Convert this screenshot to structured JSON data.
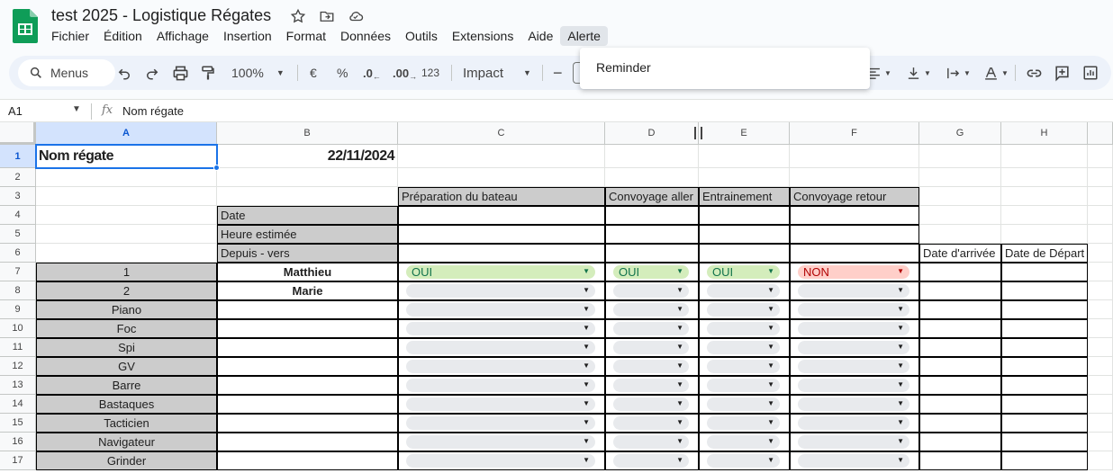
{
  "app": {
    "title": "test 2025 - Logistique Régates",
    "menu": [
      "Fichier",
      "Édition",
      "Affichage",
      "Insertion",
      "Format",
      "Données",
      "Outils",
      "Extensions",
      "Aide",
      "Alerte"
    ]
  },
  "toolbar": {
    "search_label": "Menus",
    "zoom": "100%",
    "currency": "€",
    "percent": "%",
    "dec_decrease": ".0",
    "dec_increase": ".00",
    "number_format": "123",
    "font": "Impact",
    "font_size_minus": "−"
  },
  "dropdown": {
    "item": "Reminder"
  },
  "formula_bar": {
    "cell_ref": "A1",
    "fx": "fx",
    "value": "Nom régate"
  },
  "columns": [
    "A",
    "B",
    "C",
    "D",
    "E",
    "F",
    "G",
    "H"
  ],
  "rows": [
    "1",
    "2",
    "3",
    "4",
    "5",
    "6",
    "7",
    "8",
    "9",
    "10",
    "11",
    "12",
    "13",
    "14",
    "15",
    "16",
    "17"
  ],
  "sheet": {
    "a1": "Nom régate",
    "b1": "22/11/2024",
    "c3": "Préparation du bateau",
    "d3": "Convoyage aller",
    "e3": "Entrainement",
    "f3": "Convoyage retour",
    "b4": "Date",
    "b5": "Heure estimée",
    "b6": "Depuis - vers",
    "g6": "Date d'arrivée",
    "h6": "Date de Départ",
    "col_a": [
      "1",
      "2",
      "Piano",
      "Foc",
      "Spi",
      "GV",
      "Barre",
      "Bastaques",
      "Tacticien",
      "Navigateur",
      "Grinder"
    ],
    "col_b": [
      "Matthieu",
      "Marie"
    ],
    "row7_values": {
      "c": "OUI",
      "d": "OUI",
      "e": "OUI",
      "f": "NON"
    }
  },
  "colors": {
    "green_chip": "#d4edbc",
    "red_chip": "#ffcfc9",
    "header_gray": "#cccccc",
    "selection": "#1a73e8"
  }
}
